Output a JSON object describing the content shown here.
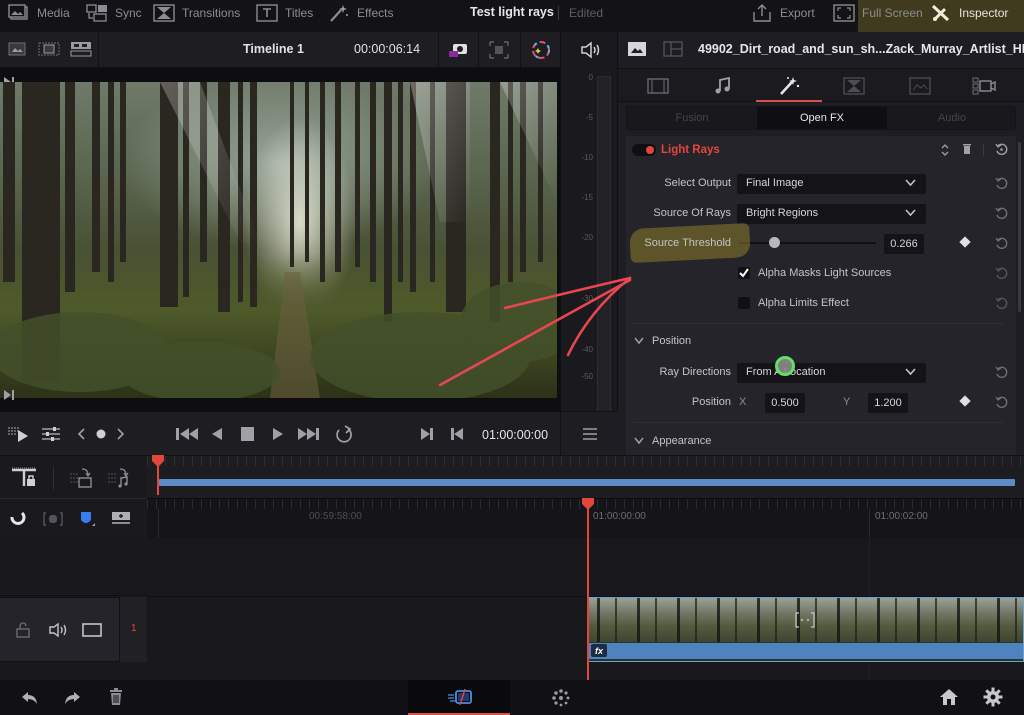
{
  "top_nav": {
    "items": [
      {
        "label": "Media",
        "icon": "media-icon"
      },
      {
        "label": "Sync",
        "icon": "sync-icon"
      },
      {
        "label": "Transitions",
        "icon": "transitions-icon"
      },
      {
        "label": "Titles",
        "icon": "titles-icon"
      },
      {
        "label": "Effects",
        "icon": "effects-wand-icon"
      }
    ],
    "project_title": "Test light rays",
    "project_status": "Edited",
    "right_items": [
      {
        "label": "Export",
        "icon": "export-icon"
      },
      {
        "label": "Full Screen",
        "icon": "fullscreen-icon"
      },
      {
        "label": "Inspector",
        "icon": "inspector-tools-icon"
      }
    ]
  },
  "viewer": {
    "timeline_name": "Timeline 1",
    "timecode": "00:00:06:14",
    "clip_description": "Forest dirt road with sun rays"
  },
  "audio_meter": {
    "scale_labels": [
      "0",
      "-5",
      "-10",
      "-15",
      "-20",
      "-30",
      "-40",
      "-50"
    ]
  },
  "transport": {
    "timecode": "01:00:00:00",
    "buttons": [
      "go-to-start",
      "play-reverse",
      "stop",
      "play",
      "go-to-end",
      "loop",
      "mark-in",
      "mark-out"
    ]
  },
  "inspector": {
    "clip_name": "49902_Dirt_road_and_sun_sh...Zack_Murray_Artlist_HD.mp4",
    "tabs": [
      "video",
      "audio",
      "effects",
      "transition",
      "image",
      "file"
    ],
    "active_tab": "effects",
    "subtabs": [
      {
        "label": "Fusion",
        "active": false
      },
      {
        "label": "Open FX",
        "active": true
      },
      {
        "label": "Audio",
        "active": false
      }
    ],
    "effect": {
      "name": "Light Rays",
      "enabled": true,
      "params": {
        "select_output": {
          "label": "Select Output",
          "value": "Final Image"
        },
        "source_of_rays": {
          "label": "Source Of Rays",
          "value": "Bright Regions"
        },
        "source_threshold": {
          "label": "Source Threshold",
          "value": "0.266",
          "slider_fraction": 0.266
        },
        "alpha_masks": {
          "label": "Alpha Masks Light Sources",
          "checked": true
        },
        "alpha_limits": {
          "label": "Alpha Limits Effect",
          "checked": false
        }
      },
      "position_section": {
        "title": "Position",
        "ray_directions": {
          "label": "Ray Directions",
          "value": "From A Location"
        },
        "position": {
          "label": "Position",
          "x_label": "X",
          "x": "0.500",
          "y_label": "Y",
          "y": "1.200"
        }
      },
      "appearance_section": {
        "title": "Appearance"
      }
    }
  },
  "timeline": {
    "ruler_labels": [
      "00:59:58:00",
      "01:00:00:00",
      "01:00:02:00"
    ],
    "track": {
      "number": "1"
    },
    "clip": {
      "fx_badge": "fx"
    }
  },
  "colors": {
    "accent_red": "#e2473c",
    "clip_blue": "#4f83bd",
    "highlight_yellow": "#8c7d28",
    "annotation_red": "#e84650",
    "cursor_green": "#5ee06a"
  }
}
